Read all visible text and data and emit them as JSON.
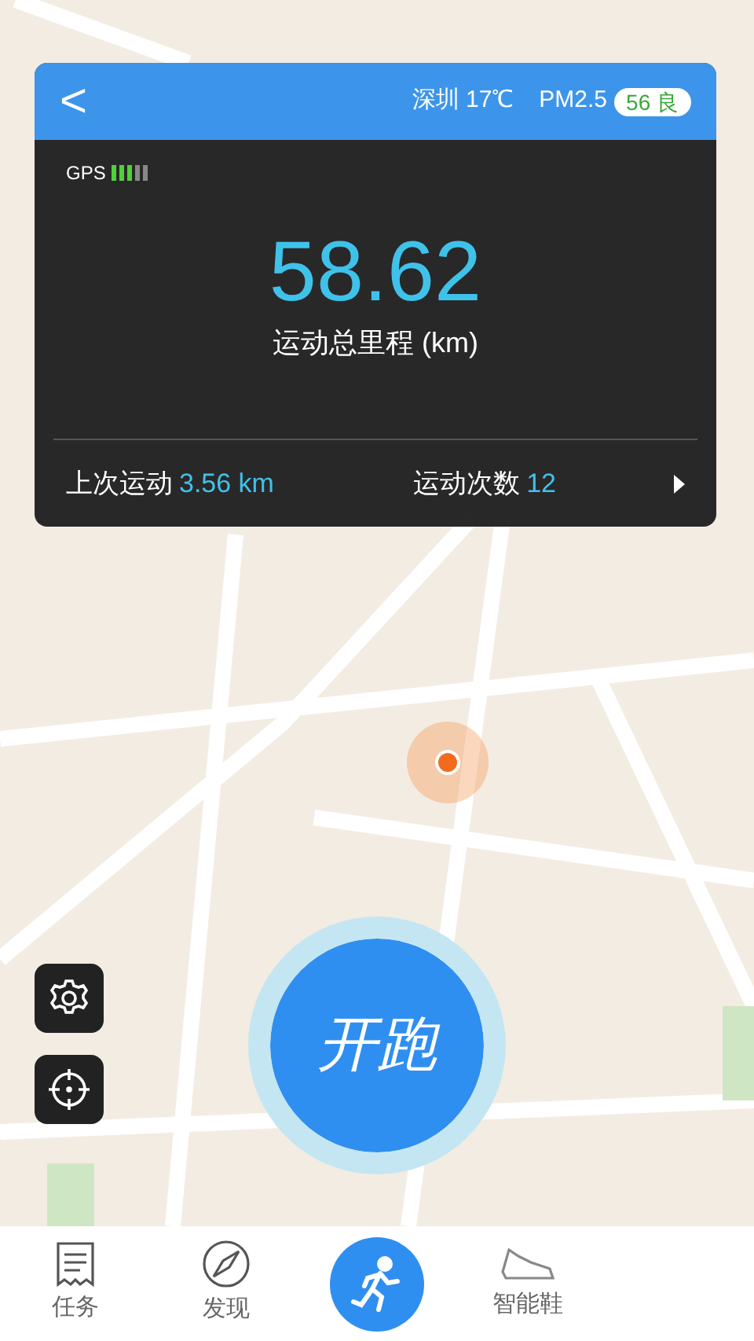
{
  "header": {
    "back": "<",
    "weather": "深圳 17℃",
    "pm_label": "PM2.5",
    "aqi": "56 良"
  },
  "stats": {
    "gps": "GPS",
    "total": "58.62",
    "total_label": "运动总里程 (km)",
    "last_label": "上次运动",
    "last_value": "3.56 km",
    "count_label": "运动次数",
    "count_value": "12"
  },
  "start_button": "开跑",
  "tabs": [
    {
      "kind": "tasks",
      "label": "任务",
      "selected": false
    },
    {
      "kind": "discover",
      "label": "发现",
      "selected": false
    },
    {
      "kind": "run",
      "selected": false
    },
    {
      "kind": "shoe",
      "label": "智能鞋",
      "selected": false
    }
  ]
}
